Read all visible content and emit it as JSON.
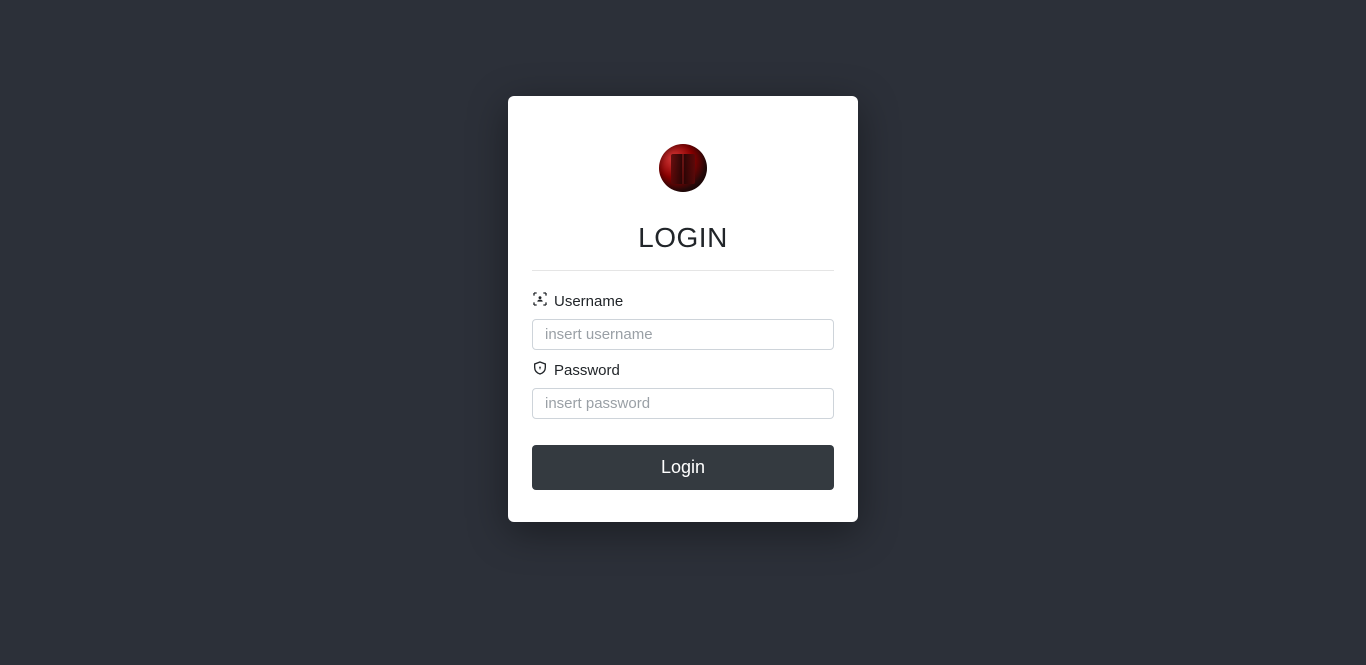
{
  "login": {
    "title": "LOGIN",
    "username_label": "Username",
    "username_placeholder": "insert username",
    "username_value": "",
    "password_label": "Password",
    "password_placeholder": "insert password",
    "password_value": "",
    "button_label": "Login"
  }
}
